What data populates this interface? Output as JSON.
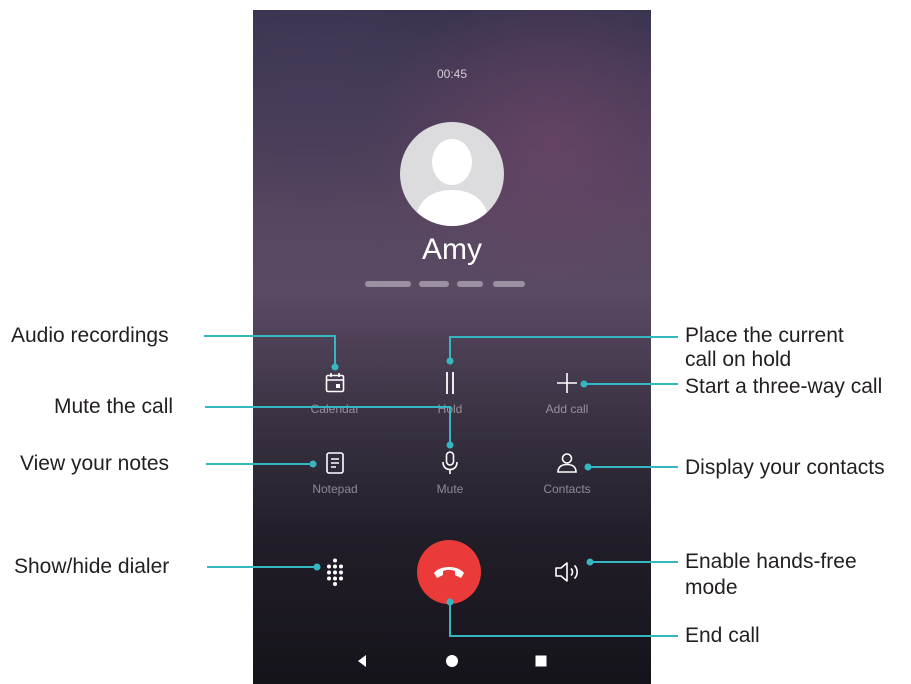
{
  "call": {
    "timer": "00:45",
    "contact_name": "Amy"
  },
  "controls": {
    "calendar": "Calendar",
    "hold": "Hold",
    "add_call": "Add call",
    "notepad": "Notepad",
    "mute": "Mute",
    "contacts": "Contacts"
  },
  "callouts": {
    "audio_recordings": "Audio recordings",
    "mute_call": "Mute the call",
    "view_notes": "View your notes",
    "show_hide_dialer": "Show/hide dialer",
    "hold_line1": "Place the current",
    "hold_line2": "call on hold",
    "three_way": "Start a three-way call",
    "display_contacts": "Display your contacts",
    "handsfree_line1": "Enable hands-free",
    "handsfree_line2": "mode",
    "end_call": "End call"
  },
  "colors": {
    "leader_line": "#35b7c2",
    "end_call_button": "#ea3a3a",
    "callout_text": "#231f20"
  },
  "icons": {
    "calendar": "calendar-icon",
    "hold": "pause-icon",
    "add_call": "plus-icon",
    "notepad": "notepad-icon",
    "mute": "microphone-icon",
    "contacts": "person-icon",
    "dialer": "dialpad-icon",
    "end_call": "phone-hangup-icon",
    "speaker": "speaker-icon",
    "back": "back-triangle-icon",
    "home": "home-circle-icon",
    "recents": "recents-square-icon"
  }
}
